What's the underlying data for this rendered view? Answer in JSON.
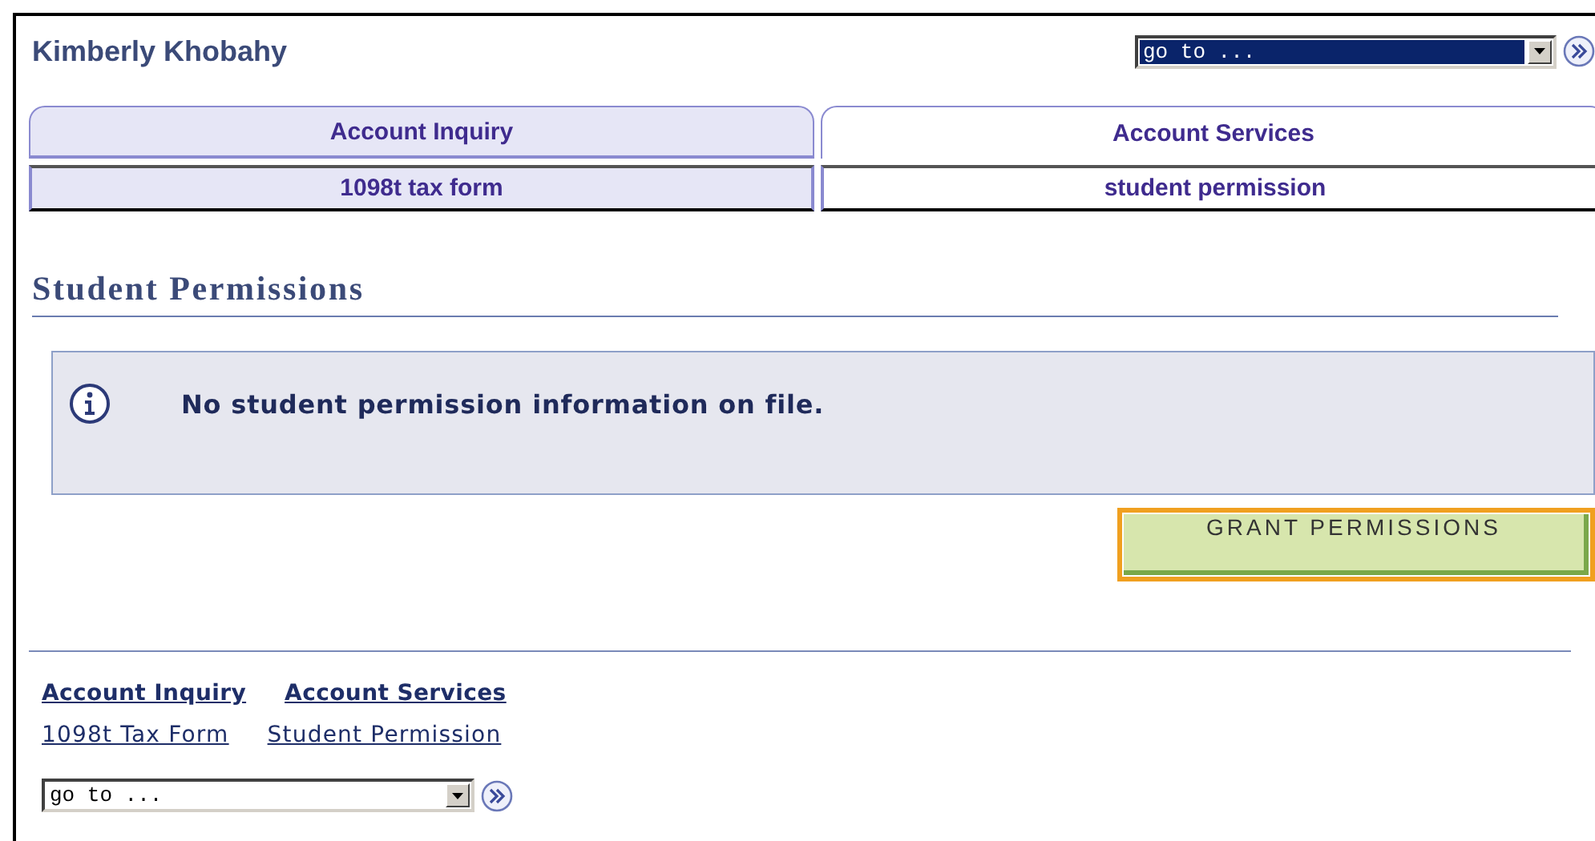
{
  "user_name": "Kimberly Khobahy",
  "top_nav": {
    "dropdown": "go to ...",
    "highlighted": true
  },
  "tabs": [
    {
      "label": "Account Inquiry",
      "selected": false
    },
    {
      "label": "Account Services",
      "selected": true
    }
  ],
  "subtabs": [
    {
      "label": "1098t tax form",
      "selected": false
    },
    {
      "label": "student permission",
      "selected": true
    }
  ],
  "page_title": "Student Permissions",
  "message": "No student permission information on file.",
  "grant_button": {
    "label": "GRANT PERMISSIONS",
    "focused": true
  },
  "footer_links": {
    "tabs": [
      "Account Inquiry",
      "Account Services"
    ],
    "subtabs": [
      "1098t Tax Form",
      "Student Permission"
    ]
  },
  "bottom_nav": {
    "dropdown": "go to ...",
    "highlighted": false
  }
}
